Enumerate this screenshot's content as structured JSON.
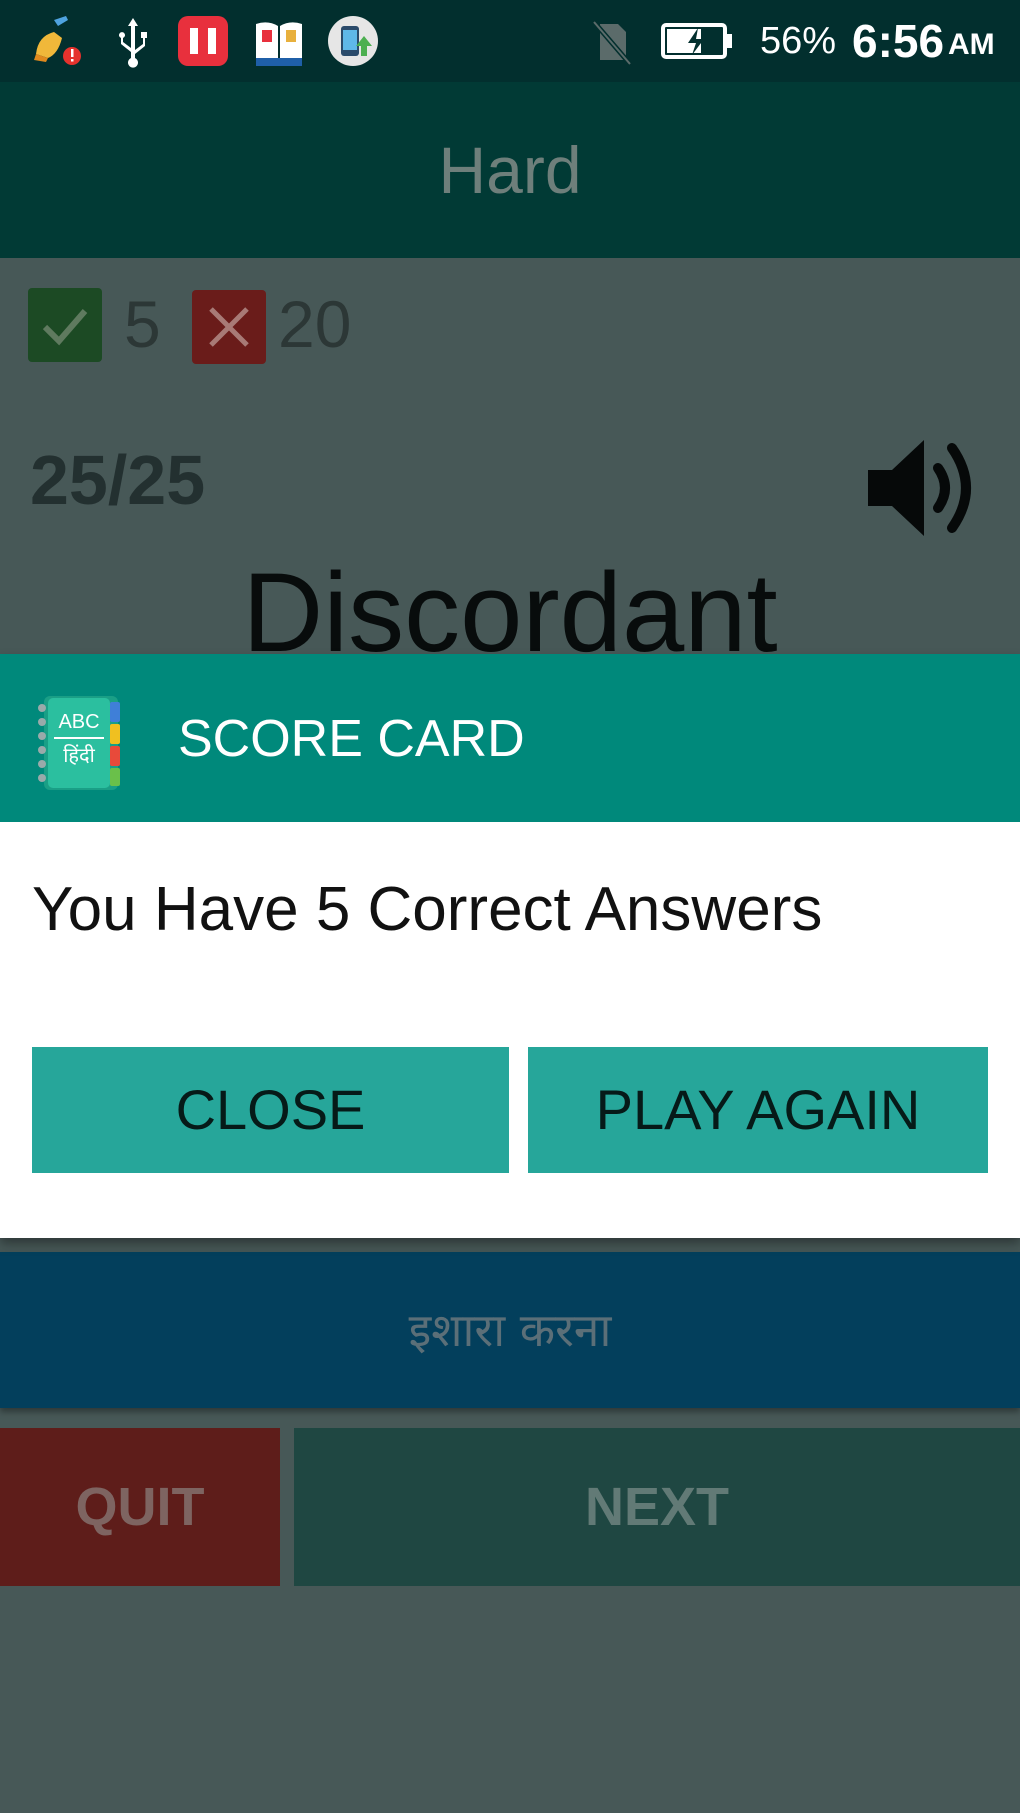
{
  "status_bar": {
    "icons": [
      "cleaner-alert-icon",
      "usb-icon",
      "app-red-icon",
      "dictionary-app-icon",
      "phone-upload-icon",
      "no-sim-icon",
      "battery-charging-icon"
    ],
    "battery_percent": "56%",
    "time": "6:56",
    "ampm": "AM"
  },
  "app_bar": {
    "title": "Hard"
  },
  "quiz": {
    "correct_count": "5",
    "wrong_count": "20",
    "progress": "25/25",
    "word": "Discordant",
    "hint_button": "इशारा करना",
    "quit_button": "QUIT",
    "next_button": "NEXT"
  },
  "dialog": {
    "logo_text_top": "ABC",
    "logo_text_bottom": "हिंदी",
    "title": "SCORE CARD",
    "message": "You Have 5 Correct Answers",
    "close_button": "CLOSE",
    "play_again_button": "PLAY AGAIN"
  },
  "colors": {
    "status_bar": "#022f2e",
    "app_bar": "#013a35",
    "dialog_header": "#00897b",
    "dialog_button": "#26a69a",
    "overlay_background": "#475857"
  }
}
